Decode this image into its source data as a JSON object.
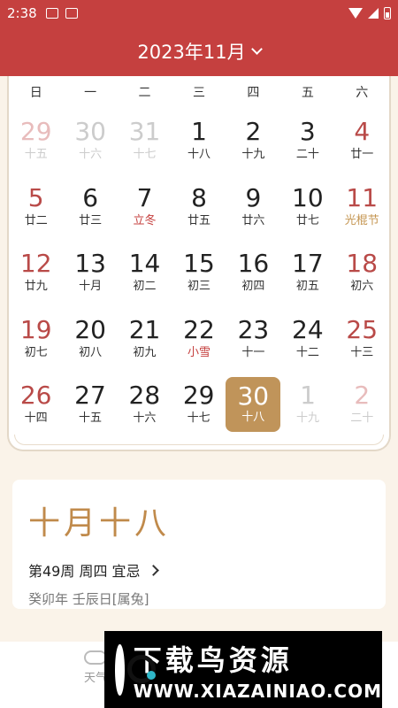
{
  "status": {
    "time": "2:38"
  },
  "header": {
    "title": "2023年11月"
  },
  "weekdays": [
    "日",
    "一",
    "二",
    "三",
    "四",
    "五",
    "六"
  ],
  "weeks": [
    [
      {
        "d": "29",
        "l": "十五"
      },
      {
        "d": "30",
        "l": "十六"
      },
      {
        "d": "31",
        "l": "十七"
      },
      {
        "d": "1",
        "l": "十八"
      },
      {
        "d": "2",
        "l": "十九"
      },
      {
        "d": "3",
        "l": "二十"
      },
      {
        "d": "4",
        "l": "廿一"
      }
    ],
    [
      {
        "d": "5",
        "l": "廿二"
      },
      {
        "d": "6",
        "l": "廿三"
      },
      {
        "d": "7",
        "l": "立冬"
      },
      {
        "d": "8",
        "l": "廿五"
      },
      {
        "d": "9",
        "l": "廿六"
      },
      {
        "d": "10",
        "l": "廿七"
      },
      {
        "d": "11",
        "l": "光棍节"
      }
    ],
    [
      {
        "d": "12",
        "l": "廿九"
      },
      {
        "d": "13",
        "l": "十月"
      },
      {
        "d": "14",
        "l": "初二"
      },
      {
        "d": "15",
        "l": "初三"
      },
      {
        "d": "16",
        "l": "初四"
      },
      {
        "d": "17",
        "l": "初五"
      },
      {
        "d": "18",
        "l": "初六"
      }
    ],
    [
      {
        "d": "19",
        "l": "初七"
      },
      {
        "d": "20",
        "l": "初八"
      },
      {
        "d": "21",
        "l": "初九"
      },
      {
        "d": "22",
        "l": "小雪"
      },
      {
        "d": "23",
        "l": "十一"
      },
      {
        "d": "24",
        "l": "十二"
      },
      {
        "d": "25",
        "l": "十三"
      }
    ],
    [
      {
        "d": "26",
        "l": "十四"
      },
      {
        "d": "27",
        "l": "十五"
      },
      {
        "d": "28",
        "l": "十六"
      },
      {
        "d": "29",
        "l": "十七"
      },
      {
        "d": "30",
        "l": "十八"
      },
      {
        "d": "1",
        "l": "十九"
      },
      {
        "d": "2",
        "l": "二十"
      }
    ]
  ],
  "info": {
    "lunar_date": "十月十八",
    "week_line": "第49周 周四 宜忌",
    "ganzhi": "癸卯年 壬辰日[属兔]"
  },
  "nav": {
    "weather_label": "天气"
  },
  "watermark": {
    "line1": "下载鸟资源",
    "line2": "WWW.XIAZAINIAO.COM"
  },
  "colors": {
    "accent": "#c5403f",
    "gold": "#c0945a"
  }
}
